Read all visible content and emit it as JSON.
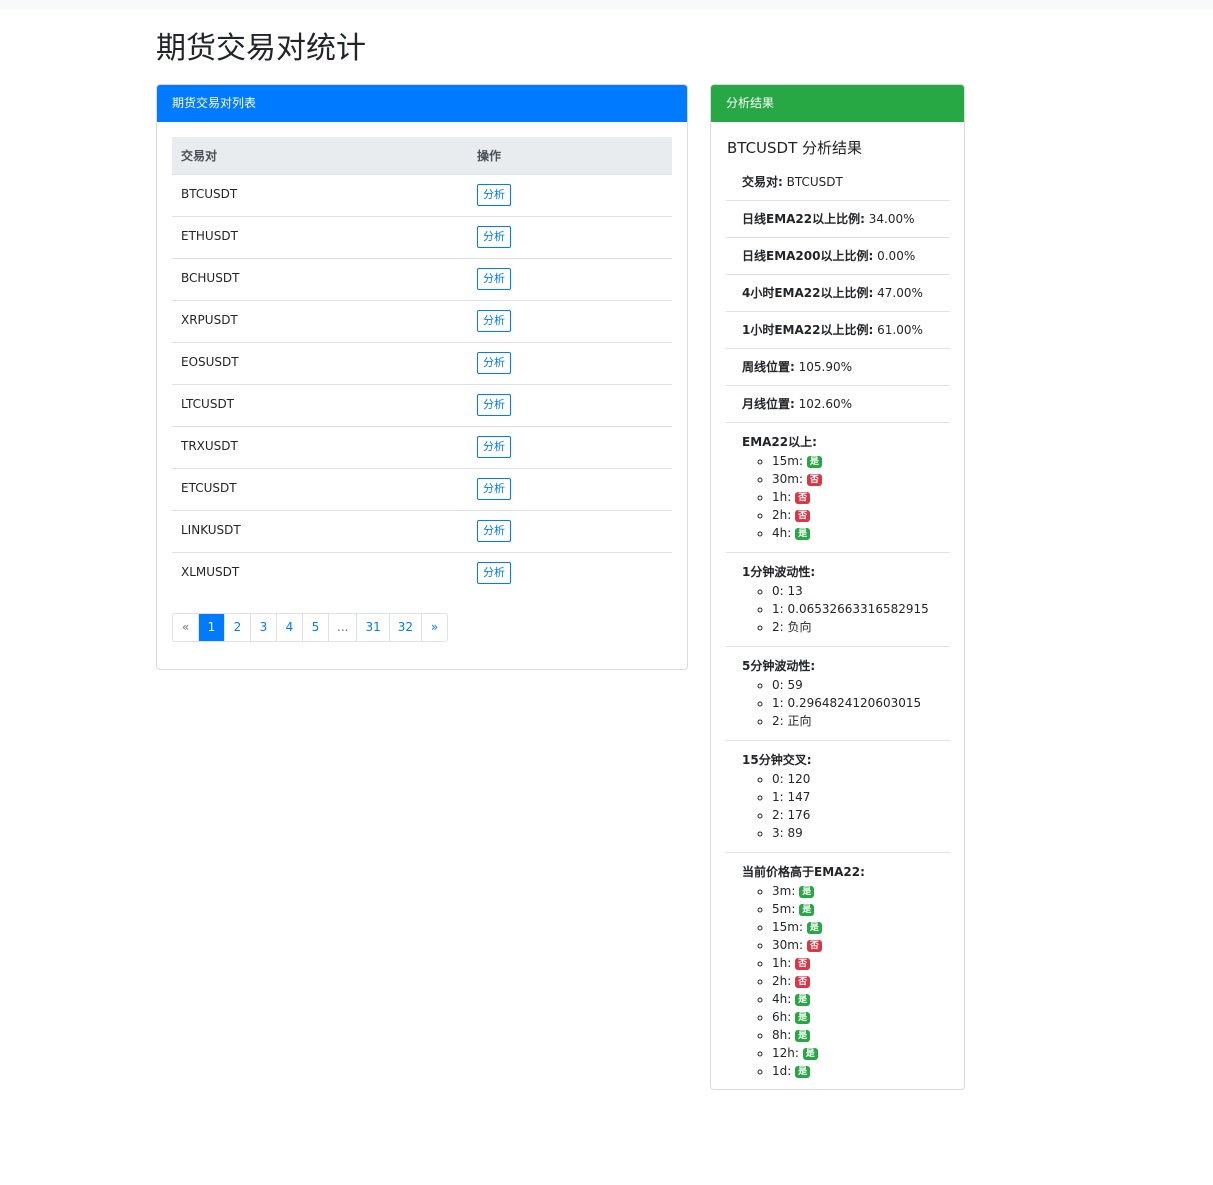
{
  "page": {
    "title": "期货交易对统计"
  },
  "pairs_card": {
    "header": "期货交易对列表",
    "columns": [
      "交易对",
      "操作"
    ],
    "rows": [
      {
        "pair": "BTCUSDT",
        "action": "分析"
      },
      {
        "pair": "ETHUSDT",
        "action": "分析"
      },
      {
        "pair": "BCHUSDT",
        "action": "分析"
      },
      {
        "pair": "XRPUSDT",
        "action": "分析"
      },
      {
        "pair": "EOSUSDT",
        "action": "分析"
      },
      {
        "pair": "LTCUSDT",
        "action": "分析"
      },
      {
        "pair": "TRXUSDT",
        "action": "分析"
      },
      {
        "pair": "ETCUSDT",
        "action": "分析"
      },
      {
        "pair": "LINKUSDT",
        "action": "分析"
      },
      {
        "pair": "XLMUSDT",
        "action": "分析"
      }
    ],
    "pagination": {
      "prev": "«",
      "pages": [
        "1",
        "2",
        "3",
        "4",
        "5",
        "...",
        "31",
        "32"
      ],
      "active": "1",
      "next": "»"
    }
  },
  "result_card": {
    "header": "分析结果",
    "title": "BTCUSDT 分析结果",
    "fields": [
      {
        "label": "交易对:",
        "value": "BTCUSDT"
      },
      {
        "label": "日线EMA22以上比例:",
        "value": "34.00%"
      },
      {
        "label": "日线EMA200以上比例:",
        "value": "0.00%"
      },
      {
        "label": "4小时EMA22以上比例:",
        "value": "47.00%"
      },
      {
        "label": "1小时EMA22以上比例:",
        "value": "61.00%"
      },
      {
        "label": "周线位置:",
        "value": "105.90%"
      },
      {
        "label": "月线位置:",
        "value": "102.60%"
      }
    ],
    "groups": [
      {
        "label": "EMA22以上:",
        "items": [
          {
            "key": "15m:",
            "badge": "是",
            "status": "yes"
          },
          {
            "key": "30m:",
            "badge": "否",
            "status": "no"
          },
          {
            "key": "1h:",
            "badge": "否",
            "status": "no"
          },
          {
            "key": "2h:",
            "badge": "否",
            "status": "no"
          },
          {
            "key": "4h:",
            "badge": "是",
            "status": "yes"
          }
        ]
      },
      {
        "label": "1分钟波动性:",
        "items": [
          {
            "key": "0:",
            "value": "13"
          },
          {
            "key": "1:",
            "value": "0.06532663316582915"
          },
          {
            "key": "2:",
            "value": "负向"
          }
        ]
      },
      {
        "label": "5分钟波动性:",
        "items": [
          {
            "key": "0:",
            "value": "59"
          },
          {
            "key": "1:",
            "value": "0.2964824120603015"
          },
          {
            "key": "2:",
            "value": "正向"
          }
        ]
      },
      {
        "label": "15分钟交叉:",
        "items": [
          {
            "key": "0:",
            "value": "120"
          },
          {
            "key": "1:",
            "value": "147"
          },
          {
            "key": "2:",
            "value": "176"
          },
          {
            "key": "3:",
            "value": "89"
          }
        ]
      },
      {
        "label": "当前价格高于EMA22:",
        "items": [
          {
            "key": "3m:",
            "badge": "是",
            "status": "yes"
          },
          {
            "key": "5m:",
            "badge": "是",
            "status": "yes"
          },
          {
            "key": "15m:",
            "badge": "是",
            "status": "yes"
          },
          {
            "key": "30m:",
            "badge": "否",
            "status": "no"
          },
          {
            "key": "1h:",
            "badge": "否",
            "status": "no"
          },
          {
            "key": "2h:",
            "badge": "否",
            "status": "no"
          },
          {
            "key": "4h:",
            "badge": "是",
            "status": "yes"
          },
          {
            "key": "6h:",
            "badge": "是",
            "status": "yes"
          },
          {
            "key": "8h:",
            "badge": "是",
            "status": "yes"
          },
          {
            "key": "12h:",
            "badge": "是",
            "status": "yes"
          },
          {
            "key": "1d:",
            "badge": "是",
            "status": "yes"
          }
        ]
      }
    ]
  }
}
